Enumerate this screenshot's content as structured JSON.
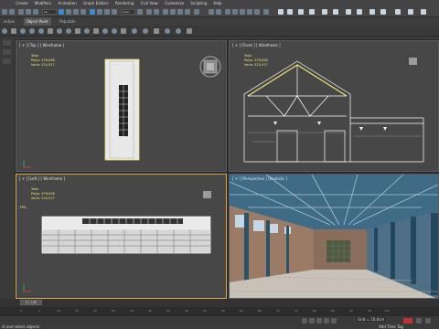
{
  "menu": [
    "",
    "Create",
    "Modifiers",
    "Animation",
    "Graph Editors",
    "Rendering",
    "Civil View",
    "Customize",
    "Scripting",
    "Help"
  ],
  "toolbar": {
    "dropdowns": [
      "All",
      "View"
    ]
  },
  "ribbon": [
    "ection",
    "Object Paint",
    "Populate"
  ],
  "viewports": {
    "top": {
      "label": "[ + ] [Top ] [ Wireframe ]"
    },
    "front": {
      "label": "[ + ] [Front ] [ Wireframe ]"
    },
    "left": {
      "label": "[ + ] [Left ] [ Wireframe ]"
    },
    "perspective": {
      "label": "[ + ] [Perspective ] [Realistic ]"
    }
  },
  "stats": {
    "total_label": "Total",
    "polys_label": "Polys:",
    "polys_value": "476,838",
    "verts_label": "Verts:",
    "verts_value": "524,917",
    "fps_label": "FPS:"
  },
  "timeline": {
    "slider_label": "0 / 100",
    "ticks": [
      "0",
      "5",
      "10",
      "15",
      "20",
      "25",
      "30",
      "35",
      "40",
      "45",
      "50",
      "55",
      "60",
      "65",
      "70",
      "75",
      "80",
      "85",
      "90",
      "95",
      "100"
    ]
  },
  "status": {
    "left_text": "ct and select objects",
    "grid_label": "Grid = 10.0cm",
    "add_time_tag": "Add Time Tag"
  },
  "colors": {
    "selection_yellow": "#f0e170",
    "active_border": "#d9a94a",
    "wire_white": "#ffffff",
    "viewport_bg": "#474747"
  }
}
